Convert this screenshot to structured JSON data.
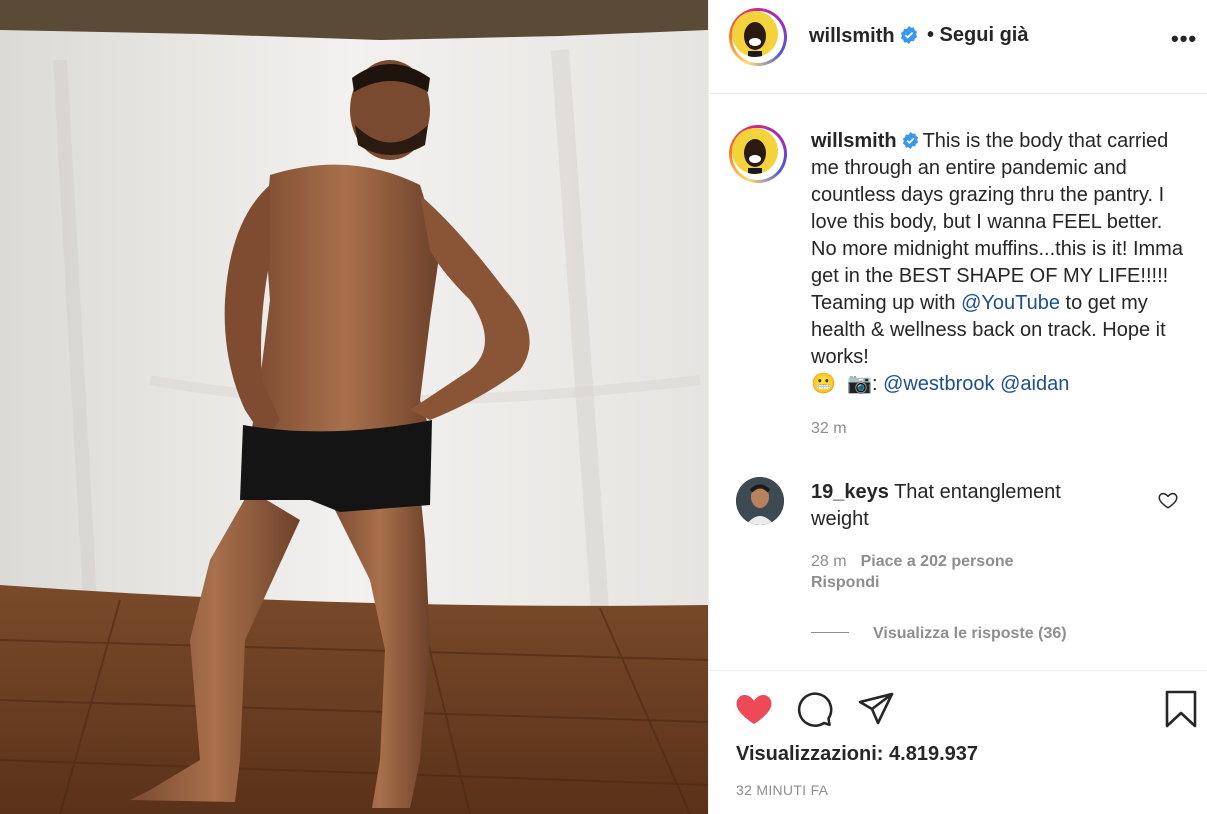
{
  "header": {
    "username": "willsmith",
    "follow_status": "• Segui già",
    "more_icon": "more-horizontal-icon"
  },
  "caption": {
    "username": "willsmith",
    "text_part1": "This is the body that carried me through an entire pandemic and countless days grazing thru the pantry. I love this body, but I wanna FEEL better. No more midnight muffins...this is it! Imma get in the BEST SHAPE OF MY LIFE!!!!! Teaming up with ",
    "mention_youtube": "@YouTube",
    "text_part2": " to get my health & wellness back on track. Hope it works!",
    "emoji_grimace": "😬",
    "emoji_camera": "📷",
    "colon": ":",
    "mention_westbrook": "@westbrook",
    "mention_aidan": "@aidan",
    "time": "32 m"
  },
  "comment": {
    "username": "19_keys",
    "text": "That entanglement weight",
    "time": "28 m",
    "likes": "Piace a 202 persone",
    "reply_label": "Rispondi",
    "view_replies": "Visualizza le risposte (36)"
  },
  "actions": {
    "views_label": "Visualizzazioni:",
    "views_count": "4.819.937",
    "time_ago": "32 MINUTI FA",
    "like_active": true,
    "like_color": "#ed4956"
  },
  "colors": {
    "text": "#262626",
    "muted": "#8e8e8e",
    "verified": "#3897f0",
    "link": "#1d4f8c"
  }
}
